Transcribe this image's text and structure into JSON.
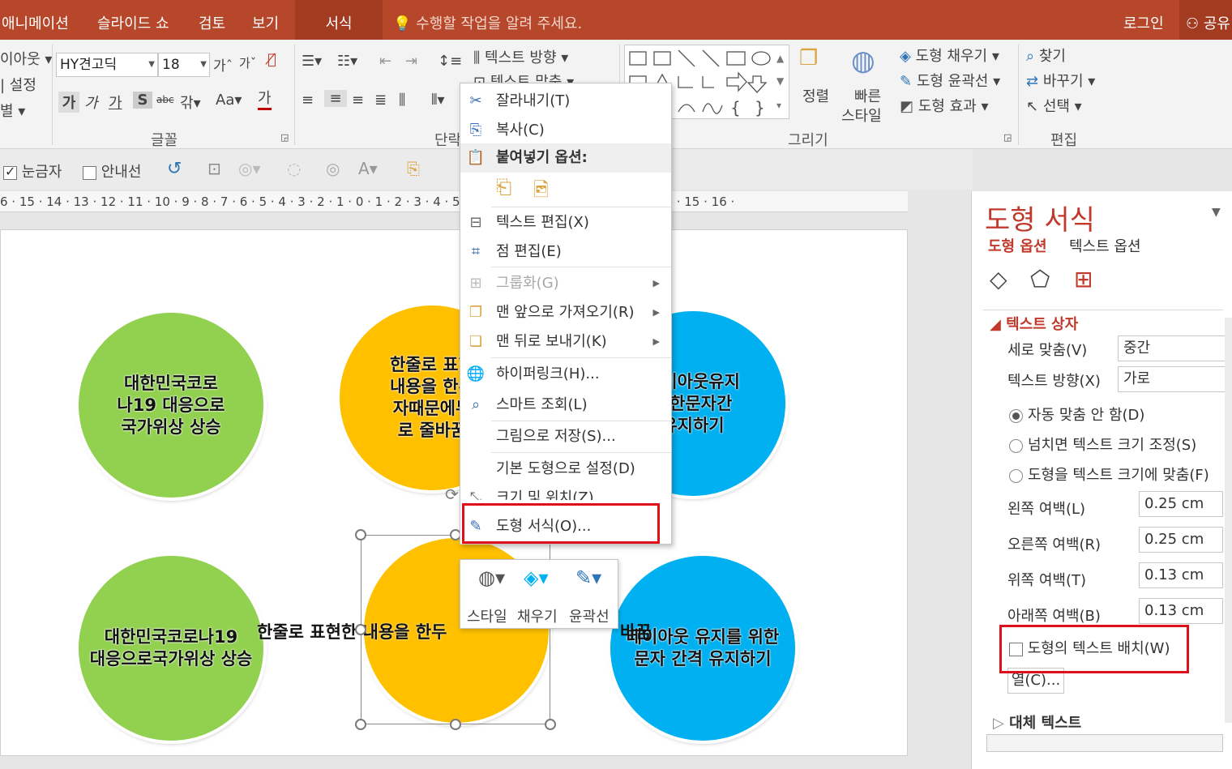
{
  "tabs": [
    {
      "label": "애니메이션"
    },
    {
      "label": "슬라이드 쇼"
    },
    {
      "label": "검토"
    },
    {
      "label": "보기"
    },
    {
      "label": "서식"
    }
  ],
  "tell_me": "수행할 작업을 알려 주세요.",
  "login": "로그인",
  "share": "공유",
  "ribbon": {
    "layout": "이아웃 ▾",
    "reset": "설정",
    "font_name": "HY견고딕",
    "font_size": "18",
    "font_group": "글꼴",
    "paragraph_group": "단락",
    "text_direction": "텍스트 방향",
    "text_align": "텍스트 맞춤",
    "arrange": "정렬",
    "quick_style_1": "빠른",
    "quick_style_2": "스타일",
    "drawing_group": "그리기",
    "shape_fill": "도형 채우기",
    "shape_outline": "도형 윤곽선",
    "shape_effect": "도형 효과",
    "find": "찾기",
    "replace": "바꾸기",
    "select": "선택",
    "editing_group": "편집",
    "btn_bold": "가",
    "btn_italic": "가",
    "btn_underline": "가",
    "btn_shadow": "S",
    "btn_strike": "abc",
    "btn_spacing": "갂",
    "btn_case": "Aa",
    "btn_color": "가"
  },
  "quickbar": {
    "ruler": "눈금자",
    "guides": "안내선"
  },
  "ruler_text": "6 · 15 · 14 · 13 · 12 · 11 · 10 · 9 · 8 · 7 · 6 · 5 · 4 · 3 · 2 · 1 · 0 · 1 · 2 · 3 · 4 · 5 · 6 · 7 · 8 · 9 · 10 · 11 · 12 · 13 · 14 · 15 · 16 ·",
  "slide": {
    "c1": "대한민국코로\n나19 대응으로\n국가위상 상승",
    "c2": "한줄로 표현\n내용을 한두\n자때문에두\n로 줄바꿈",
    "c3": "레이아웃유지\n위한문자간\n유지하기",
    "c4": "대한민국코로나19\n대응으로국가위상 상승",
    "c5_text": "한줄로 표현한 내용을 한두",
    "c5_tail": "바꿈",
    "c6": "레이아웃 유지를 위한\n문자 간격 유지하기"
  },
  "context_menu": {
    "cut": "잘라내기(T)",
    "copy": "복사(C)",
    "paste_options": "붙여넣기 옵션:",
    "edit_text": "텍스트 편집(X)",
    "edit_points": "점 편집(E)",
    "group": "그룹화(G)",
    "bring_front": "맨 앞으로 가져오기(R)",
    "send_back": "맨 뒤로 보내기(K)",
    "hyperlink": "하이퍼링크(H)...",
    "smart_lookup": "스마트 조회(L)",
    "save_picture": "그림으로 저장(S)...",
    "set_default": "기본 도형으로 설정(D)",
    "size_position": "크기 및 위치(Z)...",
    "format_shape": "도형 서식(O)..."
  },
  "mini_toolbar": {
    "style": "스타일",
    "fill": "채우기",
    "outline": "윤곽선"
  },
  "pane": {
    "title": "도형 서식",
    "tab_shape": "도형 옵션",
    "tab_text": "텍스트 옵션",
    "section_textbox": "텍스트 상자",
    "valign_label": "세로 맞춤(V)",
    "valign_value": "중간",
    "direction_label": "텍스트 방향(X)",
    "direction_value": "가로",
    "autofit_none": "자동 맞춤 안 함(D)",
    "autofit_shrink": "넘치면 텍스트 크기 조정(S)",
    "autofit_resize": "도형을 텍스트 크기에 맞춤(F)",
    "margin_left_label": "왼쪽 여백(L)",
    "margin_left": "0.25 cm",
    "margin_right_label": "오른쪽 여백(R)",
    "margin_right": "0.25 cm",
    "margin_top_label": "위쪽 여백(T)",
    "margin_top": "0.13 cm",
    "margin_bottom_label": "아래쪽 여백(B)",
    "margin_bottom": "0.13 cm",
    "wrap_text": "도형의 텍스트 배치(W)",
    "columns": "열(C)...",
    "alt_text": "대체 텍스트"
  }
}
